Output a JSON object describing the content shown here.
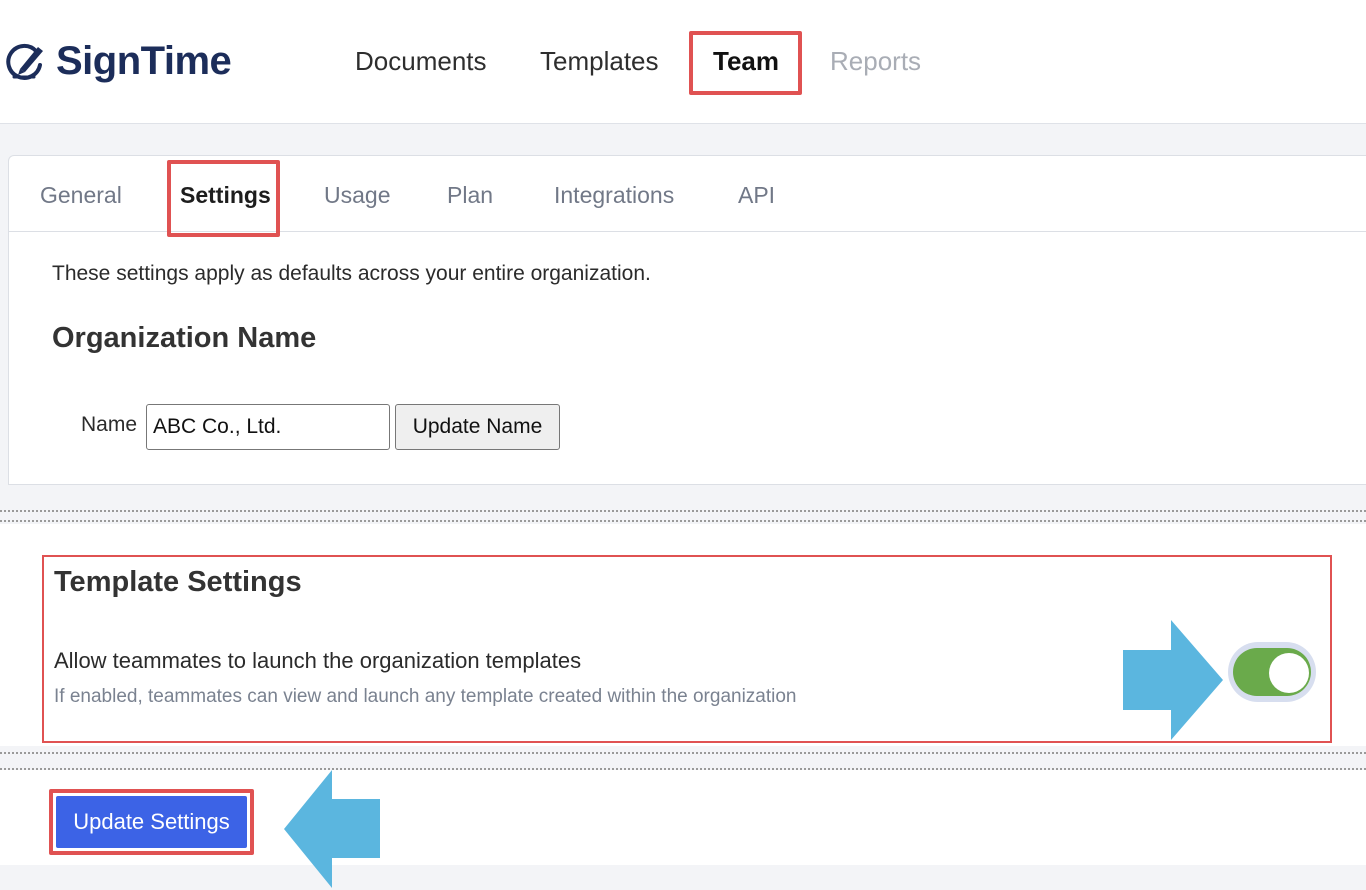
{
  "app": {
    "name": "SignTime",
    "logo_icon": "pen-signature-icon"
  },
  "nav": {
    "items": [
      {
        "label": "Documents",
        "state": "normal"
      },
      {
        "label": "Templates",
        "state": "normal"
      },
      {
        "label": "Team",
        "state": "active"
      },
      {
        "label": "Reports",
        "state": "disabled"
      }
    ]
  },
  "tabs": [
    {
      "label": "General",
      "active": false
    },
    {
      "label": "Settings",
      "active": true
    },
    {
      "label": "Usage",
      "active": false
    },
    {
      "label": "Plan",
      "active": false
    },
    {
      "label": "Integrations",
      "active": false
    },
    {
      "label": "API",
      "active": false
    }
  ],
  "settings": {
    "intro": "These settings apply as defaults across your entire organization.",
    "org_name": {
      "heading": "Organization Name",
      "label": "Name",
      "value": "ABC Co., Ltd.",
      "button": "Update Name"
    },
    "template": {
      "heading": "Template Settings",
      "option_title": "Allow teammates to launch the organization templates",
      "option_desc": "If enabled, teammates can view and launch any template created within the organization",
      "enabled": true
    },
    "submit": "Update Settings"
  },
  "colors": {
    "highlight": "#e05252",
    "arrow": "#5bb6df",
    "toggle_on": "#6aaa4b",
    "primary": "#3c63e6",
    "brand": "#1c2d5a"
  }
}
